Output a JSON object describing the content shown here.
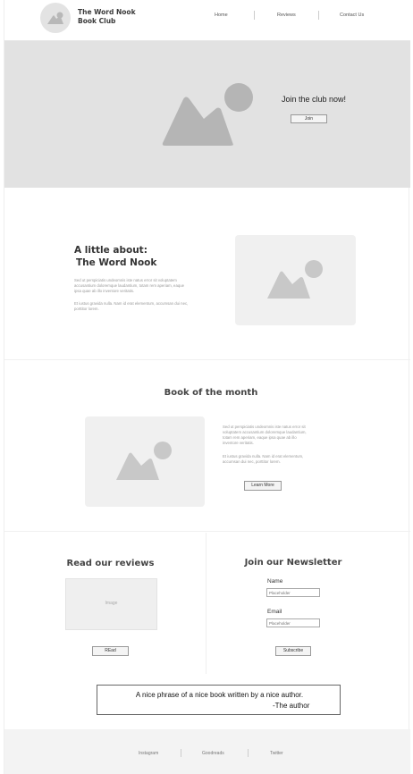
{
  "header": {
    "brand_line1": "The Word Nook",
    "brand_line2": "Book Club",
    "nav": [
      "Home",
      "Reviews",
      "Contact Us"
    ]
  },
  "hero": {
    "title": "Join the club now!",
    "button": "Join"
  },
  "about": {
    "title_line1": "A little about:",
    "title_line2": "The Word Nook",
    "para1": "Sed ut perspiciatis undeomnis iste natus error sit voluptatem accusantium doloremque laudantium, totam rem aperiam, eaque ipsa quae ab illo inventore veritatis.",
    "para2": "Et iustus gravida nulla. Nam id erat elementum, accumsan dui nec, porttitor lorem."
  },
  "book": {
    "title": "Book of the month",
    "para1": "Sed ut perspiciatis undeomnis iste natus error sit voluptatem accusantium doloremque laudantium, totam rem aperiam, eaque ipsa quae ab illo inventore veritatis.",
    "para2": "Et iustus gravida nulla. Nam id erat elementum, accumsan dui nec, porttitor lorem.",
    "button": "Learn More"
  },
  "reviews": {
    "title": "Read our reviews",
    "image_label": "Image",
    "button": "REad"
  },
  "newsletter": {
    "title": "Join our Newsletter",
    "name_label": "Name",
    "name_placeholder": "Placeholder",
    "email_label": "Email",
    "email_placeholder": "Placeholder",
    "button": "Subscribe"
  },
  "quote": {
    "text": "A nice phrase of a nice book written by a nice author.",
    "author": "-The author"
  },
  "footer": {
    "links": [
      "Instagram",
      "Goodreads",
      "Twitter"
    ]
  },
  "colors": {
    "placeholder_image": "#c2c2c2",
    "hero_bg": "#e2e2e2"
  }
}
